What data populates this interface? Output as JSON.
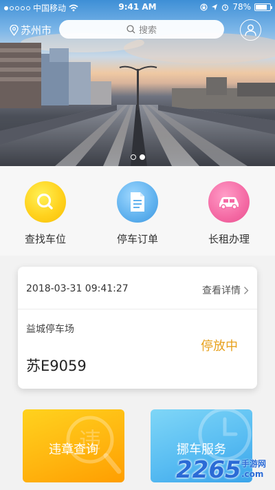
{
  "status_bar": {
    "carrier": "中国移动",
    "time": "9:41 AM",
    "battery": "78%",
    "battery_level": 0.78
  },
  "header": {
    "city": "苏州市",
    "search_placeholder": "搜索"
  },
  "banner": {
    "slide_count": 2,
    "active_slide": 2
  },
  "quick_actions": [
    {
      "label": "查找车位",
      "icon": "search-icon",
      "color": "#ffd21e"
    },
    {
      "label": "停车订单",
      "icon": "document-icon",
      "color": "#5fb1ee"
    },
    {
      "label": "长租办理",
      "icon": "car-icon",
      "color": "#f46aa4"
    }
  ],
  "parking_card": {
    "time": "2018-03-31 09:41:27",
    "detail_link": "查看详情",
    "lot_name": "益城停车场",
    "status": "停放中",
    "plate": "苏E9059"
  },
  "service_tiles": [
    {
      "label": "违章查询",
      "bg_glyph": "违",
      "color": "#ffb610"
    },
    {
      "label": "挪车服务",
      "color": "#59bdf2"
    }
  ],
  "watermark": {
    "brand": "2265",
    "tail": ".com",
    "sub": "手游网"
  }
}
